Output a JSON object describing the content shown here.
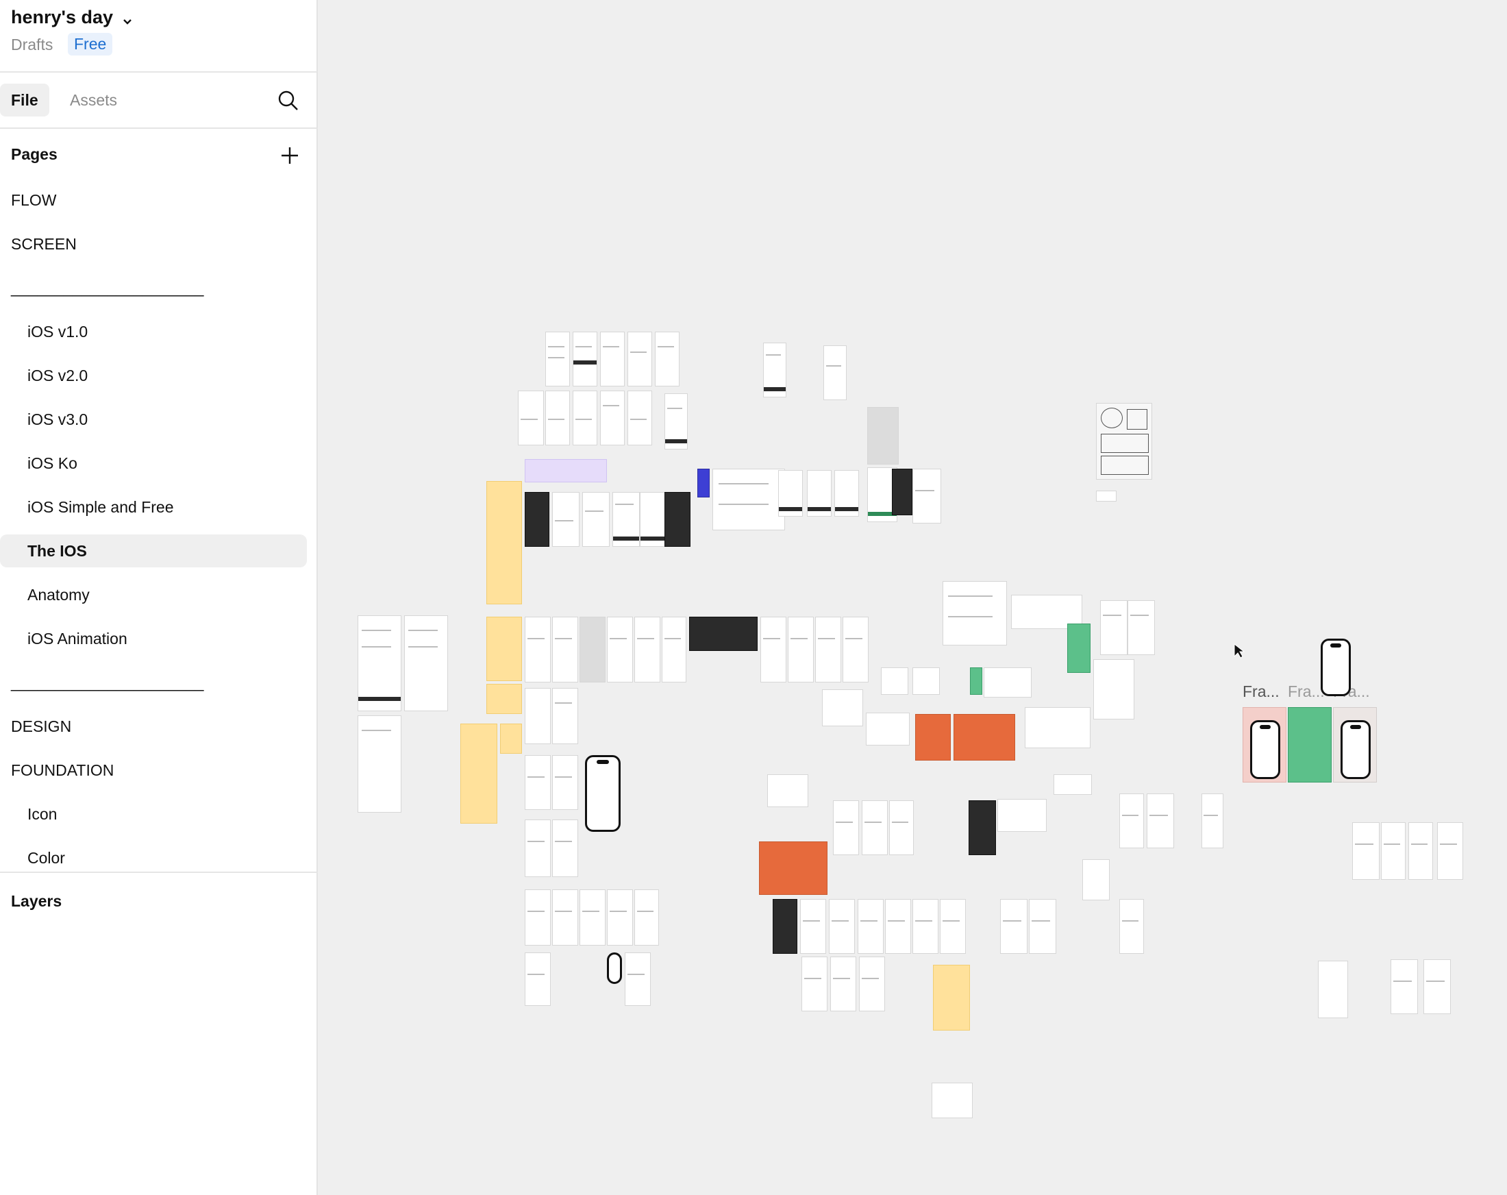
{
  "file": {
    "title": "henry's day",
    "drafts_label": "Drafts",
    "plan_badge": "Free"
  },
  "tabs": {
    "file_label": "File",
    "assets_label": "Assets"
  },
  "pages": {
    "header": "Pages",
    "items": [
      {
        "label": "FLOW",
        "indent": false,
        "selected": false
      },
      {
        "label": "SCREEN",
        "indent": false,
        "selected": false
      },
      {
        "label": "______________________",
        "indent": false,
        "selected": false
      },
      {
        "label": "iOS v1.0",
        "indent": true,
        "selected": false
      },
      {
        "label": "iOS v2.0",
        "indent": true,
        "selected": false
      },
      {
        "label": "iOS v3.0",
        "indent": true,
        "selected": false
      },
      {
        "label": "iOS Ko",
        "indent": true,
        "selected": false
      },
      {
        "label": "iOS Simple and Free",
        "indent": true,
        "selected": false
      },
      {
        "label": "The IOS",
        "indent": true,
        "selected": true
      },
      {
        "label": "Anatomy",
        "indent": true,
        "selected": false
      },
      {
        "label": "iOS Animation",
        "indent": true,
        "selected": false
      },
      {
        "label": "______________________",
        "indent": false,
        "selected": false
      },
      {
        "label": "DESIGN",
        "indent": false,
        "selected": false
      },
      {
        "label": "FOUNDATION",
        "indent": false,
        "selected": false
      },
      {
        "label": "Icon",
        "indent": true,
        "selected": false
      },
      {
        "label": "Color",
        "indent": true,
        "selected": false
      }
    ]
  },
  "layers": {
    "header": "Layers"
  },
  "canvas": {
    "frame_labels": [
      "Fra...",
      "Fra...",
      "Fra..."
    ]
  },
  "icons": {
    "title_dropdown": "chevron-down-icon",
    "search": "search-icon",
    "add_page": "plus-icon",
    "canvas_cursor": "cursor-icon"
  },
  "colors": {
    "accent": "#1e6fd0",
    "canvas_bg": "#efefef",
    "selected_page_bg": "#efefef"
  }
}
